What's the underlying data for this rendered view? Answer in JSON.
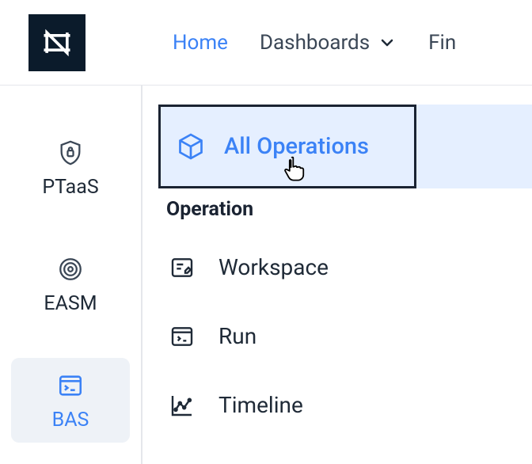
{
  "header": {
    "nav": {
      "home": "Home",
      "dashboards": "Dashboards",
      "fin": "Fin"
    }
  },
  "sidebar": {
    "items": [
      {
        "label": "PTaaS"
      },
      {
        "label": "EASM"
      },
      {
        "label": "BAS"
      }
    ]
  },
  "main": {
    "all_operations": "All Operations",
    "section": "Operation",
    "submenu": {
      "workspace": "Workspace",
      "run": "Run",
      "timeline": "Timeline"
    }
  }
}
